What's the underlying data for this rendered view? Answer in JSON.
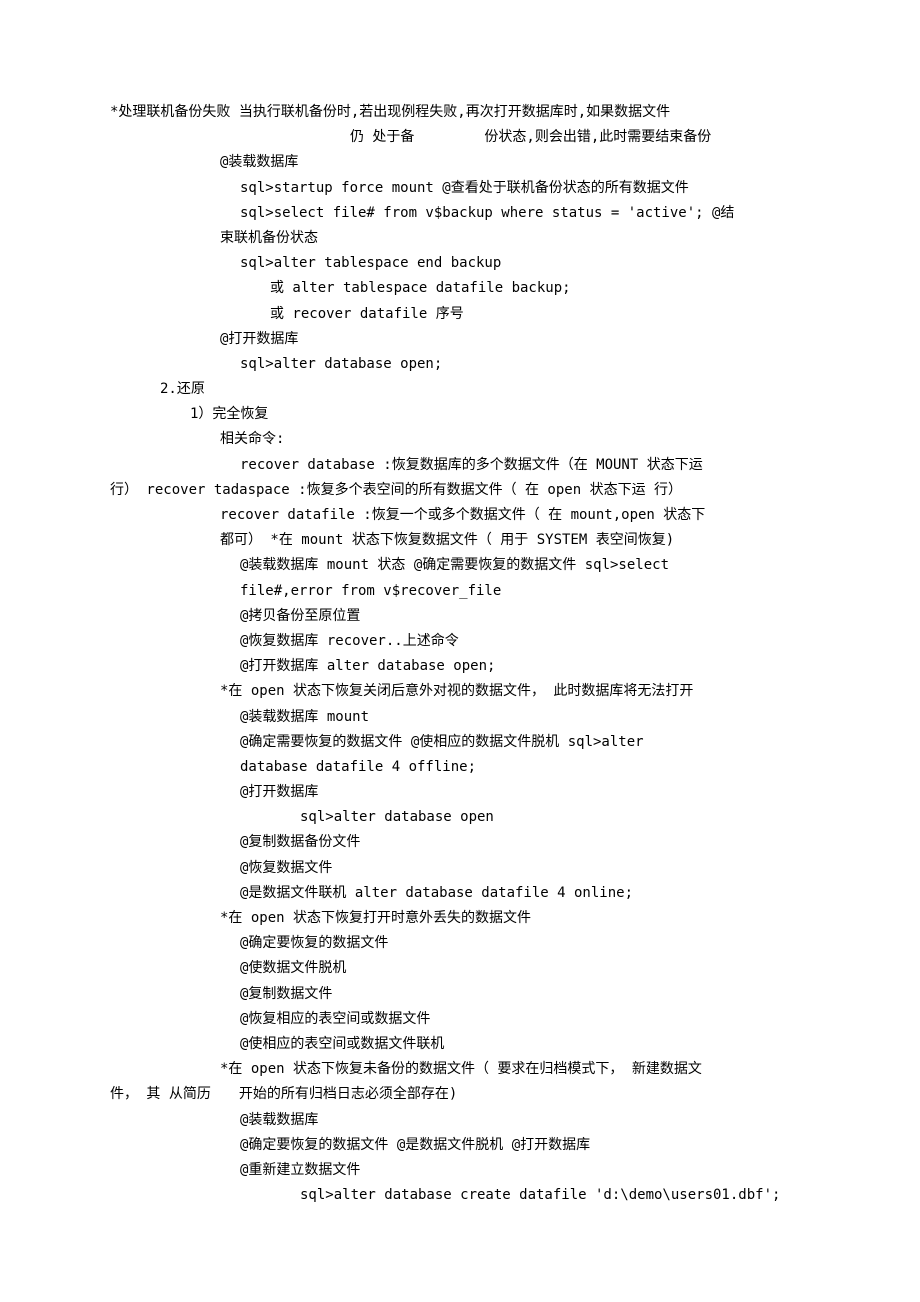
{
  "lines": [
    {
      "c": "i0",
      "t": "*处理联机备份失败 当执行联机备份时,若出现例程失败,再次打开数据库时,如果数据文件"
    },
    {
      "c": "i0",
      "t": "仍 处于备　　　　　份状态,则会出错,此时需要结束备份",
      "indent": "ix"
    },
    {
      "c": "i1",
      "t": "@装载数据库"
    },
    {
      "c": "i2",
      "t": "sql>startup force mount @查看处于联机备份状态的所有数据文件"
    },
    {
      "c": "i2",
      "t": "sql>select file# from v$backup where status = 'active'; @结"
    },
    {
      "c": "i1",
      "t": "束联机备份状态"
    },
    {
      "c": "i2",
      "t": "sql>alter tablespace end backup"
    },
    {
      "c": "i3",
      "t": "或 alter tablespace datafile backup;"
    },
    {
      "c": "i3",
      "t": "或 recover datafile 序号"
    },
    {
      "c": "i1",
      "t": "@打开数据库"
    },
    {
      "c": "i2",
      "t": "sql>alter database open;"
    },
    {
      "c": "i5",
      "t": "2.还原"
    },
    {
      "c": "i6",
      "t": "1）完全恢复"
    },
    {
      "c": "i1",
      "t": "相关命令:"
    },
    {
      "c": "i2",
      "t": "recover database :恢复数据库的多个数据文件（在 MOUNT 状态下运"
    },
    {
      "c": "i0",
      "t": "行） recover tadaspace :恢复多个表空间的所有数据文件（ 在 open 状态下运 行）"
    },
    {
      "c": "i1",
      "t": "recover datafile :恢复一个或多个数据文件（ 在 mount,open 状态下"
    },
    {
      "c": "i1",
      "t": "都可） *在 mount 状态下恢复数据文件（ 用于 SYSTEM 表空间恢复)"
    },
    {
      "c": "i2",
      "t": "@装载数据库 mount 状态 @确定需要恢复的数据文件 sql>select "
    },
    {
      "c": "i2",
      "t": "file#,error from v$recover_file"
    },
    {
      "c": "i2",
      "t": "@拷贝备份至原位置"
    },
    {
      "c": "i2",
      "t": "@恢复数据库 recover..上述命令"
    },
    {
      "c": "i2",
      "t": "@打开数据库 alter database open;"
    },
    {
      "c": "i1",
      "t": "*在 open 状态下恢复关闭后意外对视的数据文件， 此时数据库将无法打开"
    },
    {
      "c": "i2",
      "t": "@装载数据库 mount"
    },
    {
      "c": "i2",
      "t": "@确定需要恢复的数据文件 @使相应的数据文件脱机 sql>alter "
    },
    {
      "c": "i2",
      "t": "database datafile 4 offline;"
    },
    {
      "c": "i2",
      "t": "@打开数据库"
    },
    {
      "c": "i4",
      "t": "sql>alter database open"
    },
    {
      "c": "i2",
      "t": "@复制数据备份文件"
    },
    {
      "c": "i2",
      "t": "@恢复数据文件"
    },
    {
      "c": "i2",
      "t": "@是数据文件联机 alter database datafile 4 online;"
    },
    {
      "c": "i1",
      "t": "*在 open 状态下恢复打开时意外丢失的数据文件"
    },
    {
      "c": "i2",
      "t": "@确定要恢复的数据文件"
    },
    {
      "c": "i2",
      "t": "@使数据文件脱机"
    },
    {
      "c": "i2",
      "t": "@复制数据文件"
    },
    {
      "c": "i2",
      "t": "@恢复相应的表空间或数据文件"
    },
    {
      "c": "i2",
      "t": "@使相应的表空间或数据文件联机"
    },
    {
      "c": "i1",
      "t": "*在 open 状态下恢复未备份的数据文件（ 要求在归档模式下， 新建数据文"
    },
    {
      "c": "i0",
      "t": "件， 其 从简历　　开始的所有归档日志必须全部存在)"
    },
    {
      "c": "i2",
      "t": "@装载数据库"
    },
    {
      "c": "i2",
      "t": "@确定要恢复的数据文件 @是数据文件脱机 @打开数据库"
    },
    {
      "c": "i2",
      "t": "@重新建立数据文件"
    },
    {
      "c": "i4",
      "t": "sql>alter database create datafile 'd:\\demo\\users01.dbf';"
    }
  ]
}
